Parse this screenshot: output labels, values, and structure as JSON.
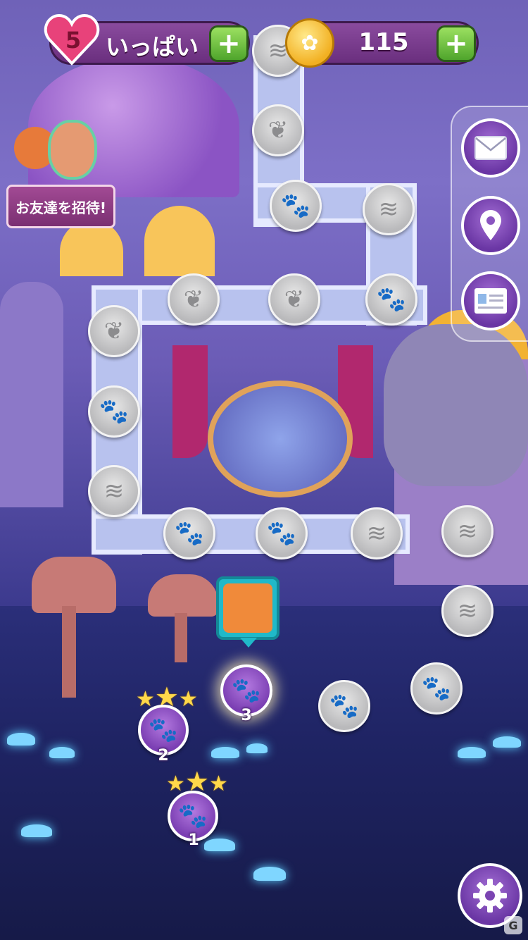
{
  "hud": {
    "lives_count": "5",
    "lives_label": "いっぱい",
    "coins": "115",
    "plus_symbol": "+"
  },
  "friends": {
    "invite_label": "お友達を招待!"
  },
  "levels": [
    {
      "number": "1",
      "stars": 3,
      "state": "completed"
    },
    {
      "number": "2",
      "stars": 3,
      "state": "completed"
    },
    {
      "number": "3",
      "stars": 0,
      "state": "current"
    }
  ],
  "side_menu": {
    "items": [
      "mail-icon",
      "map-pin-icon",
      "news-card-icon"
    ]
  },
  "locked_node_icons": [
    "paw-icon",
    "chameleon-icon",
    "scroll-icon"
  ],
  "colors": {
    "active_node": "#7b3fb3",
    "locked_node": "#b9b9bb",
    "plus_button": "#4fa52c",
    "coin": "#f2b022",
    "heart": "#e8427a"
  }
}
